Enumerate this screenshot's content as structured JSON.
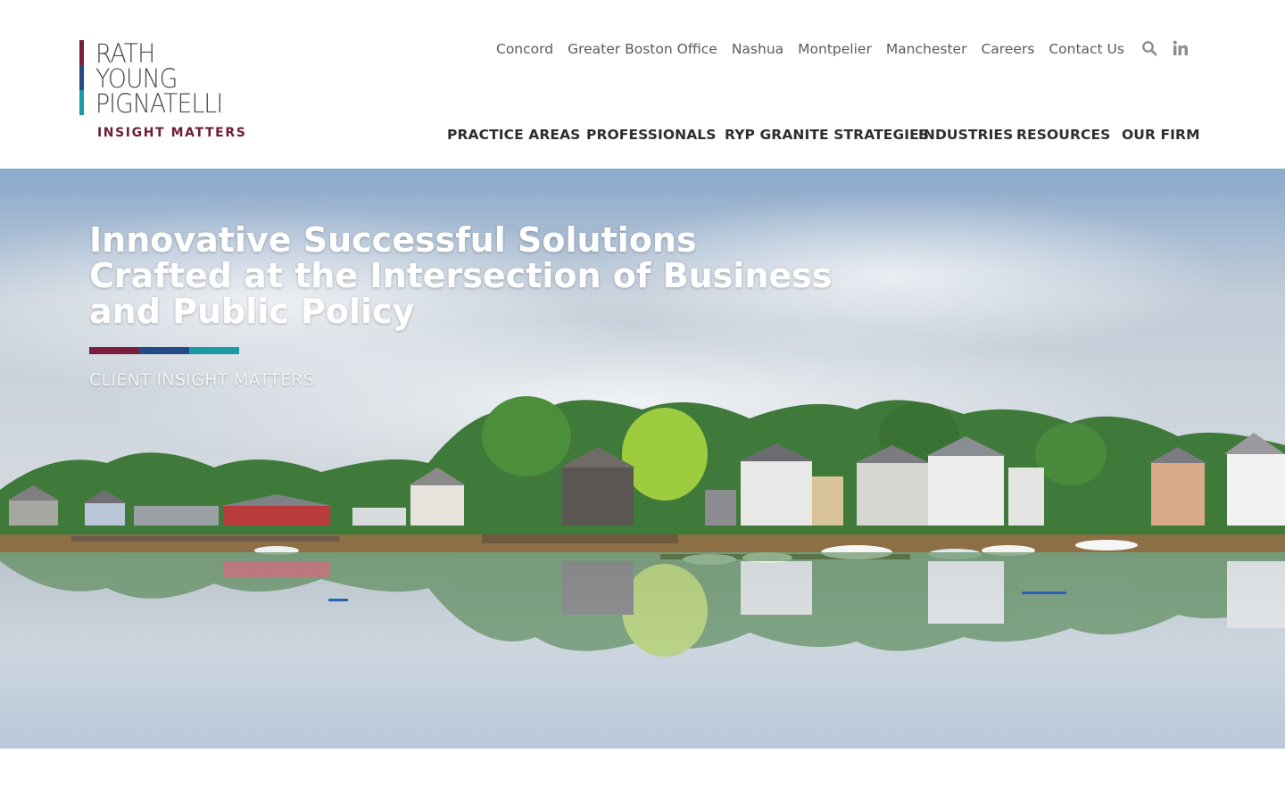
{
  "brand": {
    "logo_lines": [
      "RATH",
      "YOUNG",
      "PIGNATELLI"
    ],
    "tagline": "INSIGHT MATTERS",
    "colors": {
      "maroon": "#7a1f3b",
      "navy": "#234a86",
      "teal": "#1b9aa6"
    }
  },
  "topnav": {
    "links": [
      "Concord",
      "Greater Boston Office",
      "Nashua",
      "Montpelier",
      "Manchester",
      "Careers",
      "Contact Us"
    ],
    "icons": [
      "search-icon",
      "linkedin-icon"
    ]
  },
  "mainnav": {
    "items": [
      "PRACTICE AREAS",
      "PROFESSIONALS",
      "RYP GRANITE STRATEGIES",
      "INDUSTRIES",
      "RESOURCES",
      "OUR FIRM"
    ]
  },
  "hero": {
    "title": "Innovative Successful Solutions Crafted at the Intersection of Business and Public Policy",
    "subtitle": "CLIENT INSIGHT MATTERS"
  }
}
